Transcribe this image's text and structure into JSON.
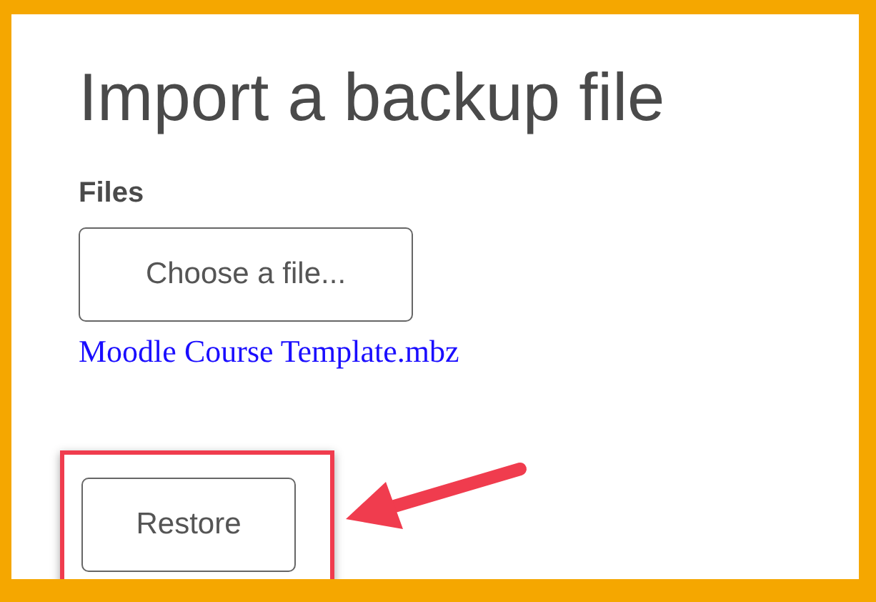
{
  "title": "Import a backup file",
  "files_label": "Files",
  "choose_button": "Choose a file...",
  "file_link": "Moodle Course Template.mbz",
  "restore_button": "Restore"
}
